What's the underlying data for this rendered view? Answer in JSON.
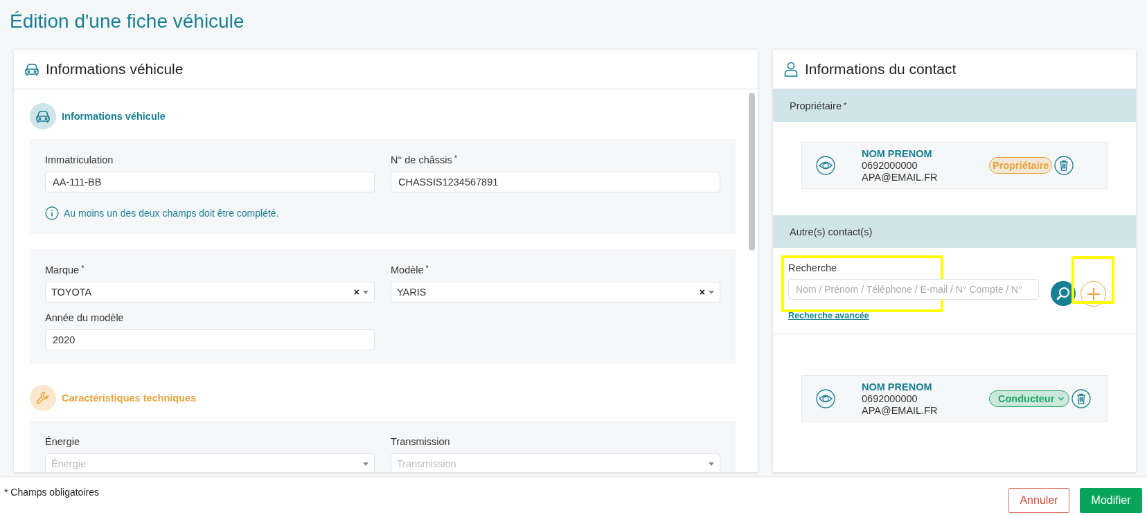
{
  "page_title": "Édition d'une fiche véhicule",
  "vehicle_panel": {
    "title": "Informations véhicule",
    "sections": [
      {
        "kind": "vehicle",
        "title": "Informations véhicule",
        "groups": [
          {
            "fields": [
              {
                "label": "Immatriculation",
                "kind": "text",
                "value": "AA-111-BB"
              },
              {
                "label": "N° de châssis",
                "mark": "*",
                "kind": "text",
                "value": "CHASSIS1234567891"
              }
            ],
            "info": "Au moins un des deux champs doit être complété."
          },
          {
            "fields": [
              {
                "label": "Marque",
                "mark": "*",
                "kind": "select",
                "value": "TOYOTA",
                "clear": "×"
              },
              {
                "label": "Modèle",
                "mark": "*",
                "kind": "select",
                "value": "YARIS",
                "clear": "×"
              },
              {
                "label": "Année du modèle",
                "kind": "text",
                "value": "2020"
              }
            ]
          }
        ]
      },
      {
        "kind": "technical",
        "title": "Caractéristiques techniques",
        "groups": [
          {
            "fields": [
              {
                "label": "Énergie",
                "kind": "select",
                "placeholder": "Énergie"
              },
              {
                "label": "Transmission",
                "kind": "select",
                "placeholder": "Transmission"
              }
            ]
          }
        ]
      }
    ]
  },
  "contact_panel": {
    "title": "Informations du contact",
    "owner": {
      "heading": "Propriétaire",
      "mark": "*",
      "contacts": [
        {
          "name": "NOM PRENOM",
          "phone": "0692000000",
          "email": "APA@EMAIL.FR",
          "role": {
            "label": "Propriétaire",
            "kind": "badge",
            "color": "#e8a33d"
          }
        }
      ]
    },
    "others": {
      "heading": "Autre(s) contact(s)",
      "search": {
        "label": "Recherche",
        "placeholder": "Nom / Prénom / Téléphone / E-mail / N° Compte / N°",
        "highlighted": true
      },
      "add_highlighted": true,
      "advanced_link": "Recherche avancée",
      "contacts": [
        {
          "name": "NOM PRENOM",
          "phone": "0692000000",
          "email": "APA@EMAIL.FR",
          "role": {
            "label": "Conducteur",
            "kind": "select",
            "color": "#1aa864"
          }
        }
      ]
    }
  },
  "footer": {
    "note": "* Champs obligatoires",
    "buttons": [
      {
        "label": "Annuler",
        "kind": "secondary"
      },
      {
        "label": "Modifier",
        "kind": "primary"
      }
    ]
  }
}
